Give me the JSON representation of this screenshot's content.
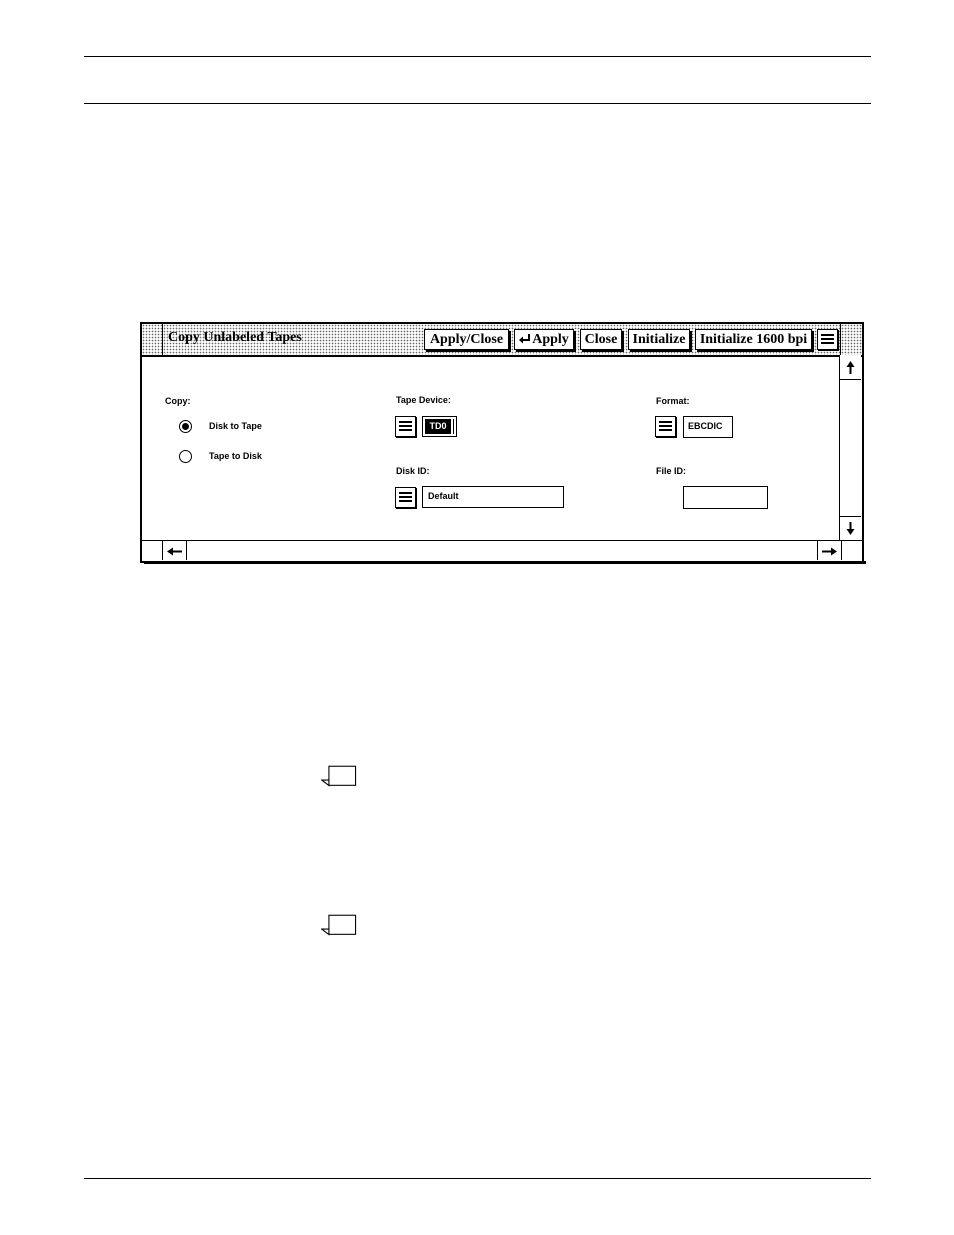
{
  "window": {
    "title": "Copy Unlabeled Tapes",
    "buttons": {
      "apply_close": "Apply/Close",
      "apply": "Apply",
      "close": "Close",
      "initialize": "Initialize",
      "initialize_1600": "Initialize 1600 bpi"
    },
    "copy": {
      "label": "Copy:",
      "options": [
        {
          "label": "Disk to Tape",
          "selected": true
        },
        {
          "label": "Tape to Disk",
          "selected": false
        }
      ]
    },
    "tape_device": {
      "label": "Tape Device:",
      "value": "TD0"
    },
    "disk_id": {
      "label": "Disk ID:",
      "value": "Default"
    },
    "format": {
      "label": "Format:",
      "value": "EBCDIC"
    },
    "file_id": {
      "label": "File ID:",
      "value": ""
    }
  },
  "icons": [
    "menu-icon",
    "return-arrow-icon",
    "scroll-up-icon",
    "scroll-down-icon",
    "scroll-left-icon",
    "scroll-right-icon",
    "note-icon"
  ]
}
